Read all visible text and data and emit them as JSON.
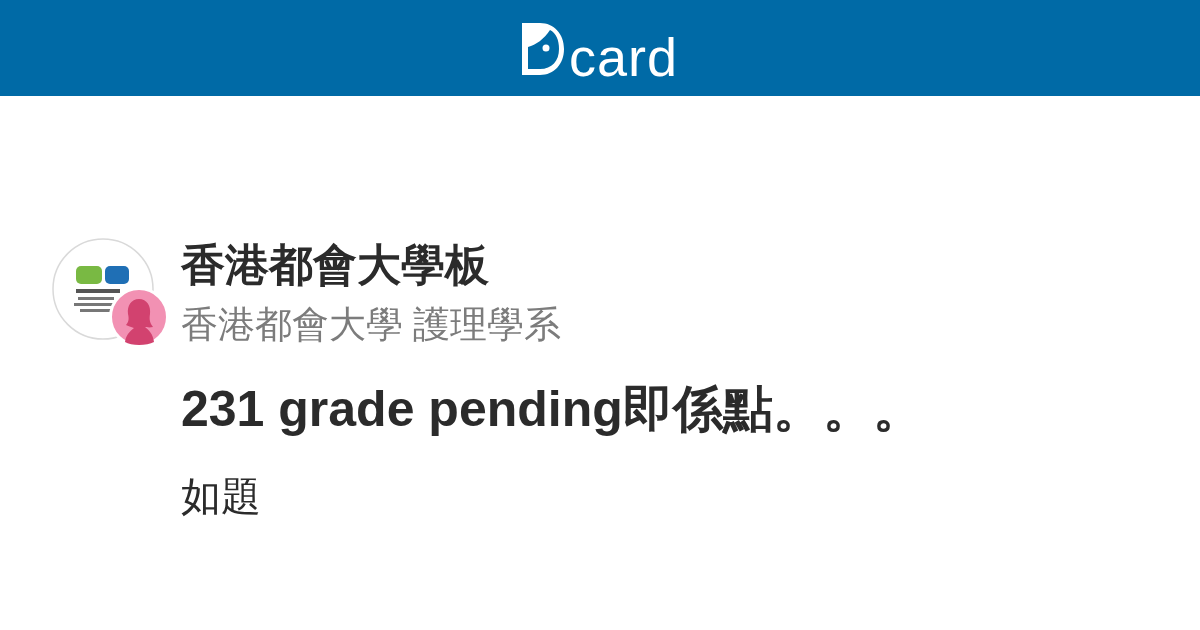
{
  "header": {
    "logo_text": "card"
  },
  "board": {
    "name": "香港都會大學板",
    "author": "香港都會大學 護理學系"
  },
  "post": {
    "title": "231 grade pending即係點。。。",
    "body": "如題"
  }
}
